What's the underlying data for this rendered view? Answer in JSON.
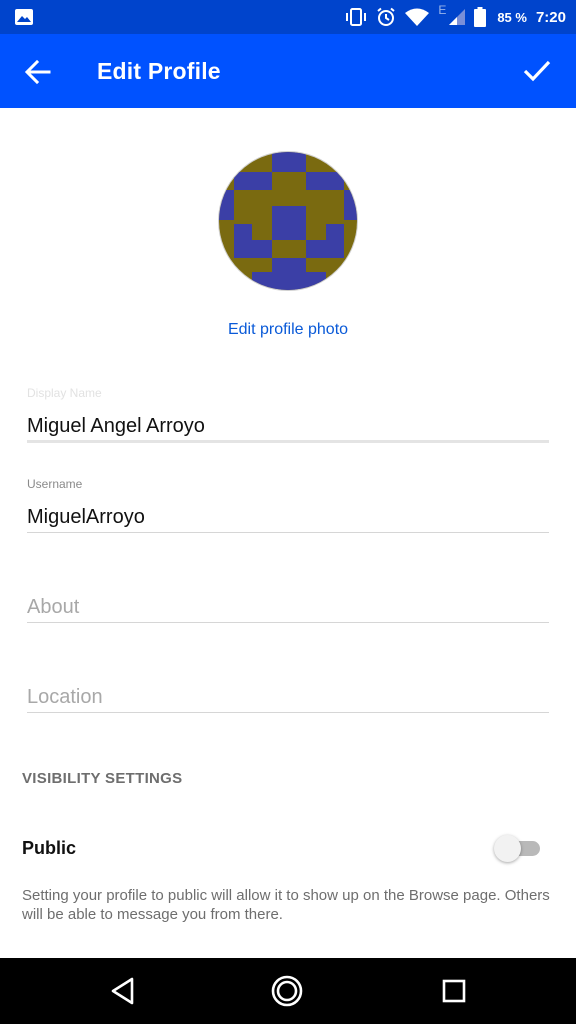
{
  "status_bar": {
    "network_type": "E",
    "battery": "85 %",
    "time": "7:20",
    "icons": [
      "image-icon",
      "vibrate-icon",
      "alarm-icon",
      "wifi-icon",
      "signal-icon",
      "battery-icon"
    ]
  },
  "app_bar": {
    "title": "Edit Profile",
    "back_icon": "arrow-back-icon",
    "done_icon": "check-icon",
    "color": "#0052ff"
  },
  "profile": {
    "edit_photo_label": "Edit profile photo",
    "avatar_colors": {
      "background": "#7a6a10",
      "pattern": "#3b3fa6"
    }
  },
  "fields": {
    "display_name": {
      "label": "Display Name",
      "value": "Miguel Angel Arroyo"
    },
    "username": {
      "label": "Username",
      "value": "MiguelArroyo"
    },
    "about": {
      "placeholder": "About"
    },
    "location": {
      "placeholder": "Location"
    }
  },
  "visibility": {
    "header": "VISIBILITY SETTINGS",
    "public_label": "Public",
    "public_enabled": false,
    "description": "Setting your profile to public will allow it to show up on the Browse page. Others will be able to message you from there."
  },
  "nav_bar": {
    "icons": [
      "nav-back-icon",
      "nav-home-icon",
      "nav-recents-icon"
    ]
  }
}
